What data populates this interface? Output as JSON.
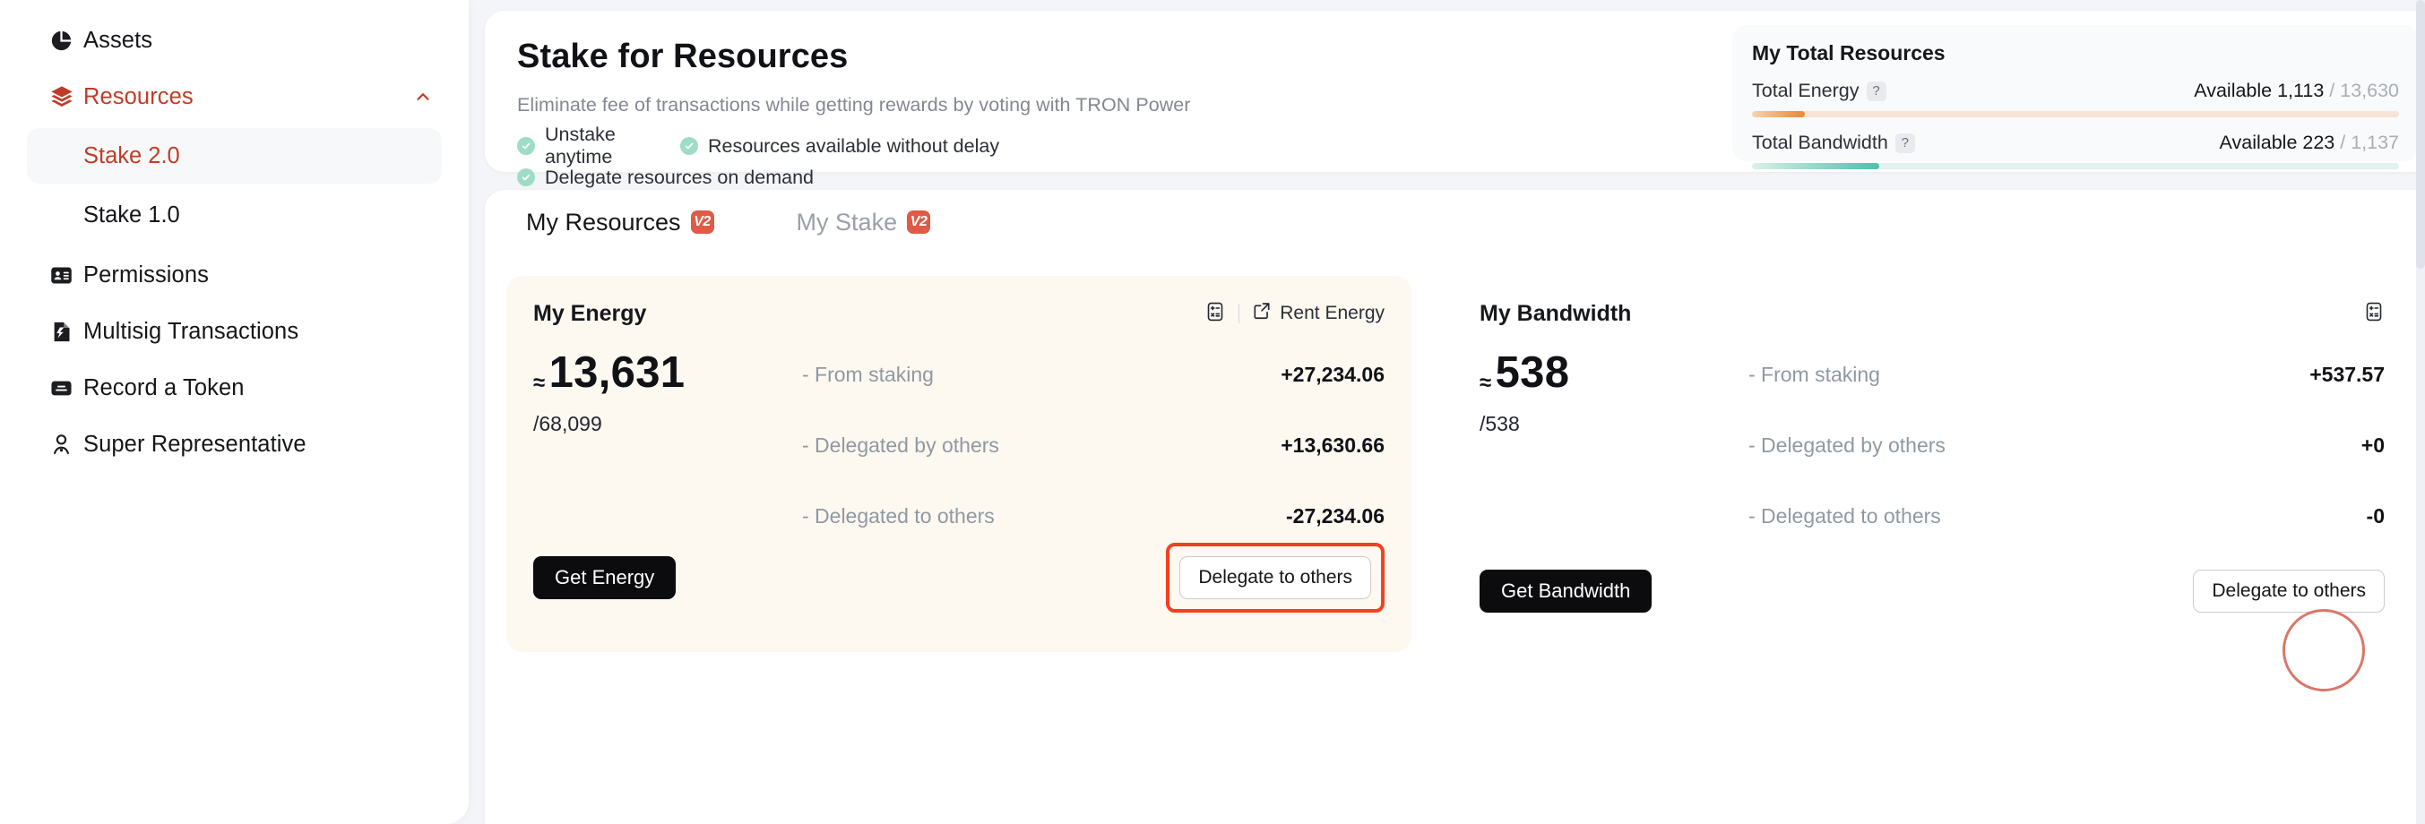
{
  "sidebar": {
    "items": [
      {
        "label": "Assets",
        "icon": "pie-chart-icon",
        "active": false
      },
      {
        "label": "Resources",
        "icon": "layers-icon",
        "active": true
      },
      {
        "label": "Permissions",
        "icon": "id-card-icon",
        "active": false
      },
      {
        "label": "Multisig Transactions",
        "icon": "document-signature-icon",
        "active": false
      },
      {
        "label": "Record a Token",
        "icon": "token-card-icon",
        "active": false
      },
      {
        "label": "Super Representative",
        "icon": "person-award-icon",
        "active": false
      }
    ],
    "subitems": [
      {
        "label": "Stake 2.0",
        "selected": true
      },
      {
        "label": "Stake 1.0",
        "selected": false
      }
    ]
  },
  "hero": {
    "title": "Stake for Resources",
    "subtitle": "Eliminate fee of transactions while getting rewards by voting with TRON Power",
    "bullets": [
      "Unstake anytime",
      "Resources available without delay",
      "Delegate resources on demand"
    ]
  },
  "totals": {
    "title": "My Total Resources",
    "rows": [
      {
        "label": "Total Energy",
        "help": "?",
        "value_prefix": "Available 1,113",
        "separator": " / ",
        "denominator": "13,630",
        "percent": 8.2,
        "color": "#e78a33"
      },
      {
        "label": "Total Bandwidth",
        "help": "?",
        "value_prefix": "Available 223",
        "separator": " / ",
        "denominator": "1,137",
        "percent": 19.6,
        "color": "#4cc0b0"
      }
    ]
  },
  "tabs": [
    {
      "label": "My Resources",
      "badge": "V2",
      "active": true
    },
    {
      "label": "My Stake",
      "badge": "V2",
      "active": false
    }
  ],
  "energy_card": {
    "title": "My Energy",
    "rent_label": "Rent Energy",
    "approx": "≈",
    "amount": "13,631",
    "denominator": "/68,099",
    "rows": [
      {
        "label": "- From staking",
        "value": "+27,234.06"
      },
      {
        "label": "- Delegated by others",
        "value": "+13,630.66"
      },
      {
        "label": "- Delegated to others",
        "value": "-27,234.06"
      }
    ],
    "primary_button": "Get Energy",
    "secondary_button": "Delegate to others",
    "highlight_color": "#f4401f"
  },
  "bandwidth_card": {
    "title": "My Bandwidth",
    "approx": "≈",
    "amount": "538",
    "denominator": "/538",
    "rows": [
      {
        "label": "- From staking",
        "value": "+537.57"
      },
      {
        "label": "- Delegated by others",
        "value": "+0"
      },
      {
        "label": "- Delegated to others",
        "value": "-0"
      }
    ],
    "primary_button": "Get Bandwidth",
    "secondary_button": "Delegate to others"
  },
  "colors": {
    "page_bg": "#f4f5f9",
    "brand_red": "#c03c28",
    "badge_red": "#e05a45",
    "energy_card_bg": "#fdf8f0",
    "tick_green": "#9fdcc8"
  }
}
